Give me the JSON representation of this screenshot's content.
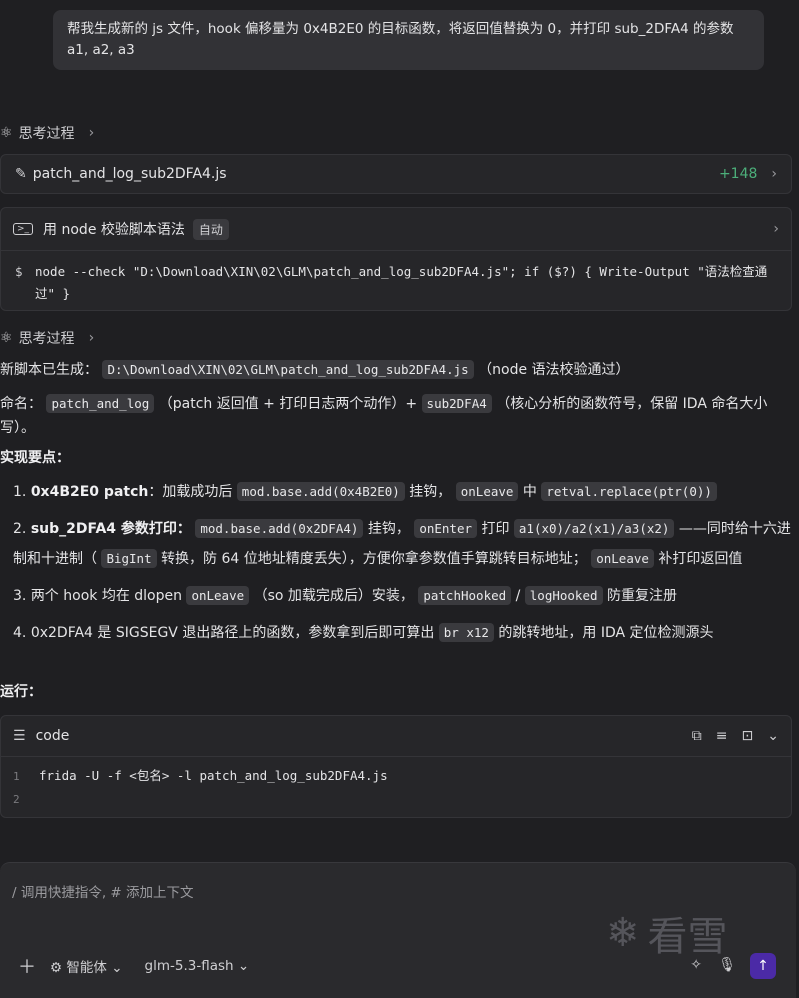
{
  "user_message": "帮我生成新的 js 文件，hook 偏移量为 0x4B2E0 的目标函数，将返回值替换为 0，并打印 sub_2DFA4 的参数 a1, a2, a3",
  "think_label": "思考过程",
  "file": {
    "name": "patch_and_log_sub2DFA4.js",
    "count": "+148"
  },
  "command": {
    "title": "用 node 校验脚本语法",
    "badge": "自动",
    "text": "node --check \"D:\\Download\\XIN\\02\\GLM\\patch_and_log_sub2DFA4.js\"; if ($?) { Write-Output \"语法检查通过\" }"
  },
  "summary": {
    "generated_label": "新脚本已生成：",
    "path": "D:\\Download\\XIN\\02\\GLM\\patch_and_log_sub2DFA4.js",
    "generated_note": "（node 语法校验通过）",
    "naming_label": "命名：",
    "naming_code1": "patch_and_log",
    "naming_text1": "（patch 返回值 + 打印日志两个动作）+",
    "naming_code2": "sub2DFA4",
    "naming_text2": "（核心分析的函数符号，保留 IDA 命名大小写）。",
    "points_label": "实现要点：",
    "run_label": "运行："
  },
  "points": {
    "p1_bold": "0x4B2E0 patch",
    "p1_t1": "：加载成功后",
    "p1_c1": "mod.base.add(0x4B2E0)",
    "p1_t2": "挂钩，",
    "p1_c2": "onLeave",
    "p1_t3": "中",
    "p1_c3": "retval.replace(ptr(0))",
    "p2_bold": "sub_2DFA4 参数打印：",
    "p2_c1": "mod.base.add(0x2DFA4)",
    "p2_t1": "挂钩，",
    "p2_c2": "onEnter",
    "p2_t2": "打印",
    "p2_c3": "a1(x0)/a2(x1)/a3(x2)",
    "p2_t3": "——同时给十六进制和十进制（",
    "p2_c4": "BigInt",
    "p2_t4": "转换，防 64 位地址精度丢失），方便你拿参数值手算跳转目标地址；",
    "p2_c5": "onLeave",
    "p2_t5": "补打印返回值",
    "p3_t1": "两个 hook 均在 dlopen",
    "p3_c1": "onLeave",
    "p3_t2": "（so 加载完成后）安装，",
    "p3_c2": "patchHooked",
    "p3_t3": "/",
    "p3_c3": "logHooked",
    "p3_t4": "防重复注册",
    "p4_t1": "0x2DFA4 是 SIGSEGV 退出路径上的函数，参数拿到后即可算出",
    "p4_c1": "br x12",
    "p4_t2": "的跳转地址，用 IDA 定位检测源头"
  },
  "code_block": {
    "lang": "code",
    "lines": [
      {
        "num": "1",
        "text": "frida -U -f <包名> -l patch_and_log_sub2DFA4.js"
      },
      {
        "num": "2",
        "text": ""
      }
    ]
  },
  "input": {
    "placeholder": "/ 调用快捷指令, # 添加上下文",
    "agent_label": "智能体",
    "model_label": "glm-5.3-flash"
  },
  "watermark_text": "看雪"
}
